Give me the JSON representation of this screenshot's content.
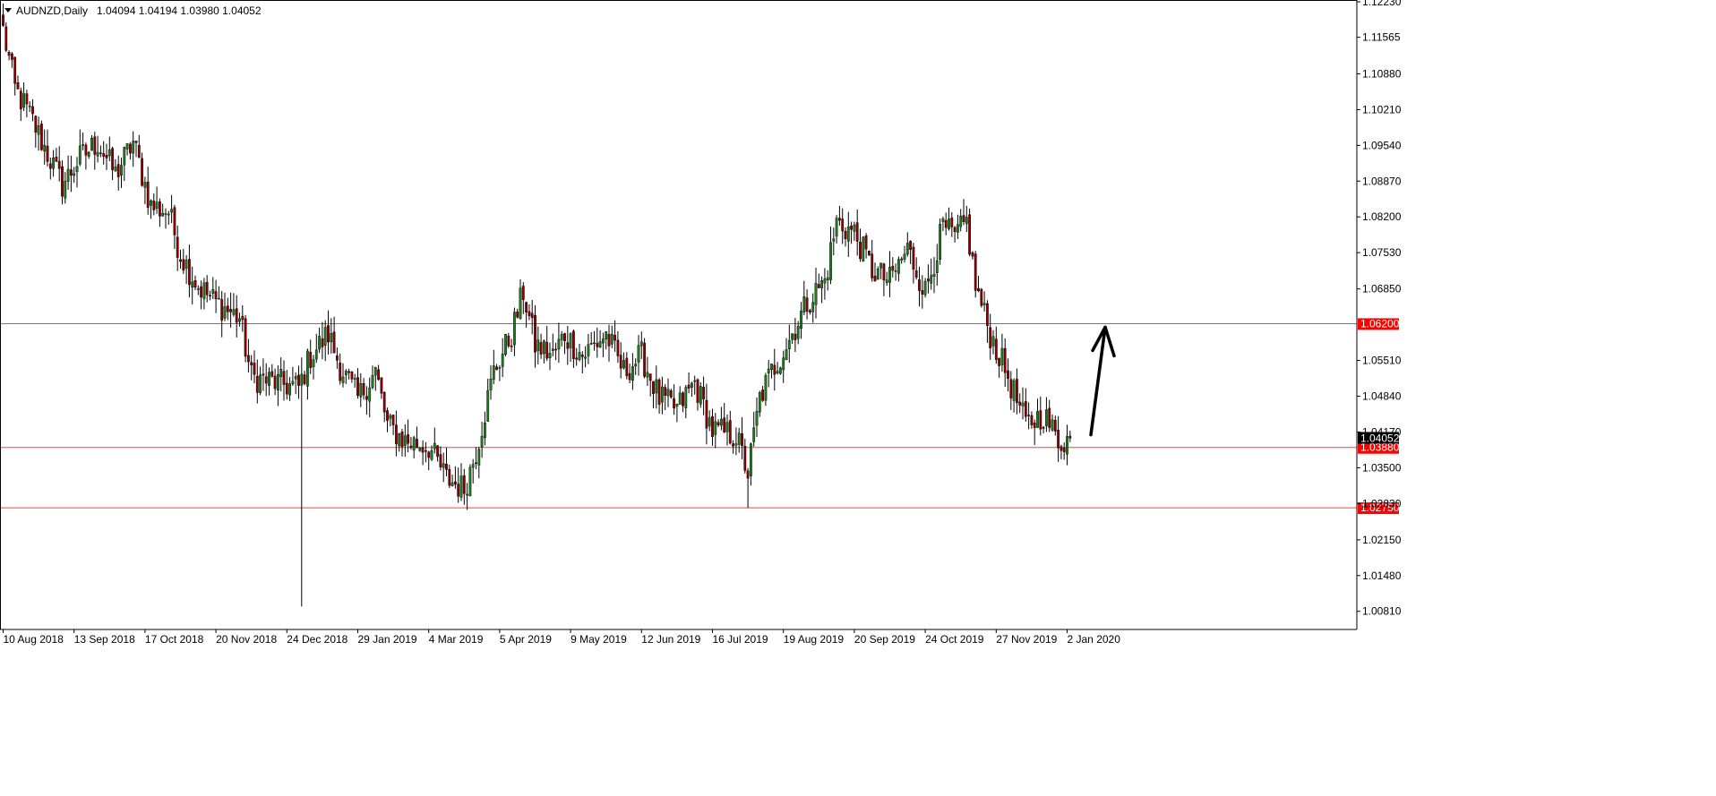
{
  "header": {
    "dropdown_icon": "triangle-down-icon",
    "symbol": "AUDNZD,Daily",
    "ohlc": "1.04094 1.04194 1.03980 1.04052"
  },
  "colors": {
    "background": "#ffffff",
    "axis": "#000000",
    "bull": "#1f7a1f",
    "bear": "#8b0000",
    "wick": "#000000",
    "level_line": "#ff3b3b",
    "level_box": "#ff0000",
    "last_box": "#000000",
    "arrow": "#000000"
  },
  "chart_data": {
    "type": "candlestick",
    "symbol": "AUDNZD",
    "timeframe": "Daily",
    "ylim": [
      1.0047,
      1.1223
    ],
    "y_ticks": [
      "1.12230",
      "1.11565",
      "1.10880",
      "1.10210",
      "1.09540",
      "1.08870",
      "1.08200",
      "1.07530",
      "1.06850",
      "1.05510",
      "1.04840",
      "1.04170",
      "1.03500",
      "1.02830",
      "1.02150",
      "1.01480",
      "1.00810"
    ],
    "x_labels": [
      "10 Aug 2018",
      "13 Sep 2018",
      "17 Oct 2018",
      "20 Nov 2018",
      "24 Dec 2018",
      "29 Jan 2019",
      "4 Mar 2019",
      "5 Apr 2019",
      "9 May 2019",
      "12 Jun 2019",
      "16 Jul 2019",
      "19 Aug 2019",
      "20 Sep 2019",
      "24 Oct 2019",
      "27 Nov 2019",
      "2 Jan 2020"
    ],
    "bars_per_label": 24,
    "total_bars": 362,
    "anchors": [
      [
        0,
        1.117
      ],
      [
        4,
        1.106
      ],
      [
        10,
        1.1
      ],
      [
        14,
        1.095
      ],
      [
        20,
        1.088
      ],
      [
        26,
        1.093
      ],
      [
        32,
        1.096
      ],
      [
        38,
        1.09
      ],
      [
        44,
        1.096
      ],
      [
        50,
        1.084
      ],
      [
        56,
        1.083
      ],
      [
        60,
        1.075
      ],
      [
        66,
        1.069
      ],
      [
        72,
        1.066
      ],
      [
        80,
        1.063
      ],
      [
        84,
        1.052
      ],
      [
        92,
        1.051
      ],
      [
        100,
        1.05
      ],
      [
        104,
        1.056
      ],
      [
        110,
        1.06
      ],
      [
        114,
        1.054
      ],
      [
        120,
        1.048
      ],
      [
        126,
        1.053
      ],
      [
        130,
        1.043
      ],
      [
        136,
        1.04
      ],
      [
        144,
        1.039
      ],
      [
        150,
        1.033
      ],
      [
        156,
        1.031
      ],
      [
        160,
        1.038
      ],
      [
        166,
        1.053
      ],
      [
        172,
        1.06
      ],
      [
        176,
        1.068
      ],
      [
        180,
        1.058
      ],
      [
        186,
        1.056
      ],
      [
        190,
        1.06
      ],
      [
        196,
        1.056
      ],
      [
        204,
        1.06
      ],
      [
        210,
        1.053
      ],
      [
        216,
        1.056
      ],
      [
        222,
        1.048
      ],
      [
        228,
        1.046
      ],
      [
        234,
        1.051
      ],
      [
        240,
        1.042
      ],
      [
        248,
        1.041
      ],
      [
        252,
        1.034
      ],
      [
        256,
        1.048
      ],
      [
        260,
        1.053
      ],
      [
        266,
        1.059
      ],
      [
        272,
        1.066
      ],
      [
        278,
        1.07
      ],
      [
        282,
        1.081
      ],
      [
        288,
        1.079
      ],
      [
        294,
        1.072
      ],
      [
        300,
        1.07
      ],
      [
        306,
        1.076
      ],
      [
        312,
        1.068
      ],
      [
        318,
        1.08
      ],
      [
        322,
        1.078
      ],
      [
        326,
        1.081
      ],
      [
        329,
        1.069
      ],
      [
        334,
        1.06
      ],
      [
        340,
        1.052
      ],
      [
        346,
        1.043
      ],
      [
        352,
        1.045
      ],
      [
        357,
        1.04
      ],
      [
        361,
        1.0405
      ]
    ],
    "extreme_wicks": [
      {
        "bar": 101,
        "low": 1.009
      },
      {
        "bar": 252,
        "low": 1.0275
      }
    ],
    "last": {
      "open": 1.04094,
      "high": 1.04194,
      "low": 1.0398,
      "close": 1.04052
    },
    "horizontal_levels": [
      {
        "value": 1.062,
        "label": "1.06200"
      },
      {
        "value": 1.0388,
        "label": "1.03880"
      },
      {
        "value": 1.0275,
        "label": "1.02750"
      }
    ],
    "last_price_label": "1.04052",
    "annotation": {
      "type": "arrow",
      "direction": "up",
      "from_price": 1.0405,
      "to_price": 1.062
    }
  }
}
